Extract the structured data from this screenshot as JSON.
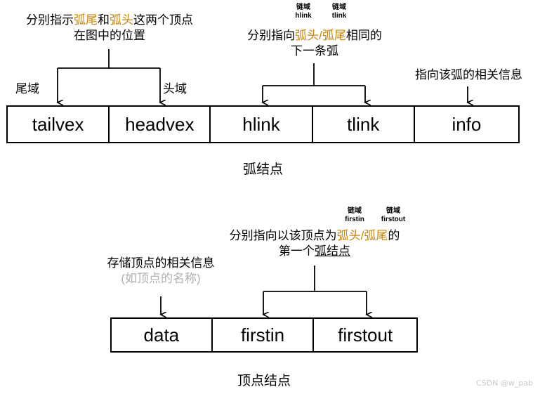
{
  "diagram": {
    "title_arc": "弧结点",
    "title_vertex": "顶点结点"
  },
  "arc_node": {
    "caption": "弧结点",
    "fields": [
      {
        "name": "tailvex",
        "label": "tailvex"
      },
      {
        "name": "headvex",
        "label": "headvex"
      },
      {
        "name": "hlink",
        "label": "hlink"
      },
      {
        "name": "tlink",
        "label": "tlink"
      },
      {
        "name": "info",
        "label": "info"
      }
    ],
    "side_labels": {
      "tail": "尾域",
      "head": "头域"
    },
    "tiny_labels": [
      {
        "domain": "链域",
        "field": "hlink"
      },
      {
        "domain": "链域",
        "field": "tlink"
      }
    ],
    "annotations": {
      "vertex_position": {
        "line1_a": "分别指示",
        "line1_hl1": "弧尾",
        "line1_b": "和",
        "line1_hl2": "弧头",
        "line1_c": "这两个顶点",
        "line2": "在图中的位置"
      },
      "next_arc": {
        "line1_a": "分别指向",
        "line1_hl1": "弧头",
        "line1_slash": "/",
        "line1_hl2": "弧尾",
        "line1_b": "相同的",
        "line2": "下一条弧"
      },
      "info": "指向该弧的相关信息"
    }
  },
  "vertex_node": {
    "caption": "顶点结点",
    "fields": [
      {
        "name": "data",
        "label": "data"
      },
      {
        "name": "firstin",
        "label": "firstin"
      },
      {
        "name": "firstout",
        "label": "firstout"
      }
    ],
    "tiny_labels": [
      {
        "domain": "链域",
        "field": "firstin"
      },
      {
        "domain": "链域",
        "field": "firstout"
      }
    ],
    "annotations": {
      "data": {
        "line1": "存储顶点的相关信息",
        "line2": "(如顶点的名称)"
      },
      "first_arc": {
        "line1_a": "分别指向以该顶点为",
        "line1_hl1": "弧头",
        "line1_slash": "/",
        "line1_hl2": "弧尾",
        "line1_b": "的",
        "line2_a": "第一个",
        "line2_u": "弧结点"
      }
    }
  },
  "watermark": {
    "text": "CSDN @w_pab"
  },
  "colors": {
    "highlight": "#c8860d",
    "gray_text": "#b0b0b0",
    "stroke": "#000000",
    "watermark": "#c9c9c9"
  }
}
